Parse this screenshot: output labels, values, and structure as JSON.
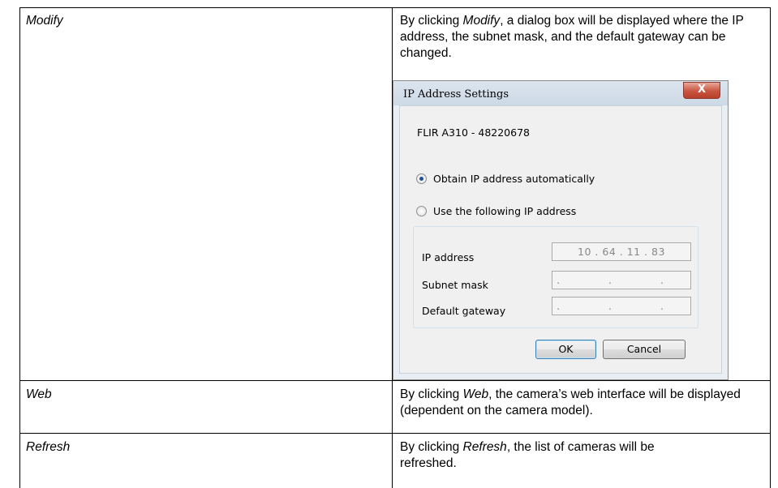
{
  "rows": [
    {
      "term": "Modify",
      "desc_parts": [
        "By clicking ",
        "Modify",
        ", a dialog box will be displayed where the IP address, the subnet mask, and the default gateway can be changed."
      ]
    },
    {
      "term": "Web",
      "desc_parts": [
        "By clicking ",
        "Web",
        ", the camera’s web interface will be displayed (dependent on the camera model)."
      ]
    },
    {
      "term": "Refresh",
      "desc_parts": [
        "By clicking ",
        "Refresh",
        ", the list of cameras will be refreshed."
      ]
    }
  ],
  "dialog": {
    "title": "IP Address Settings",
    "close_label": "X",
    "device": "FLIR A310 - 48220678",
    "radio_auto": "Obtain IP address automatically",
    "radio_manual": "Use the following IP address",
    "selected": "auto",
    "fields": {
      "ip_label": "IP address",
      "ip_value": "10 . 64 . 11 . 83",
      "subnet_label": "Subnet mask",
      "subnet_value": ". . .",
      "gateway_label": "Default gateway",
      "gateway_value": ". . ."
    },
    "ok_label": "OK",
    "cancel_label": "Cancel"
  }
}
